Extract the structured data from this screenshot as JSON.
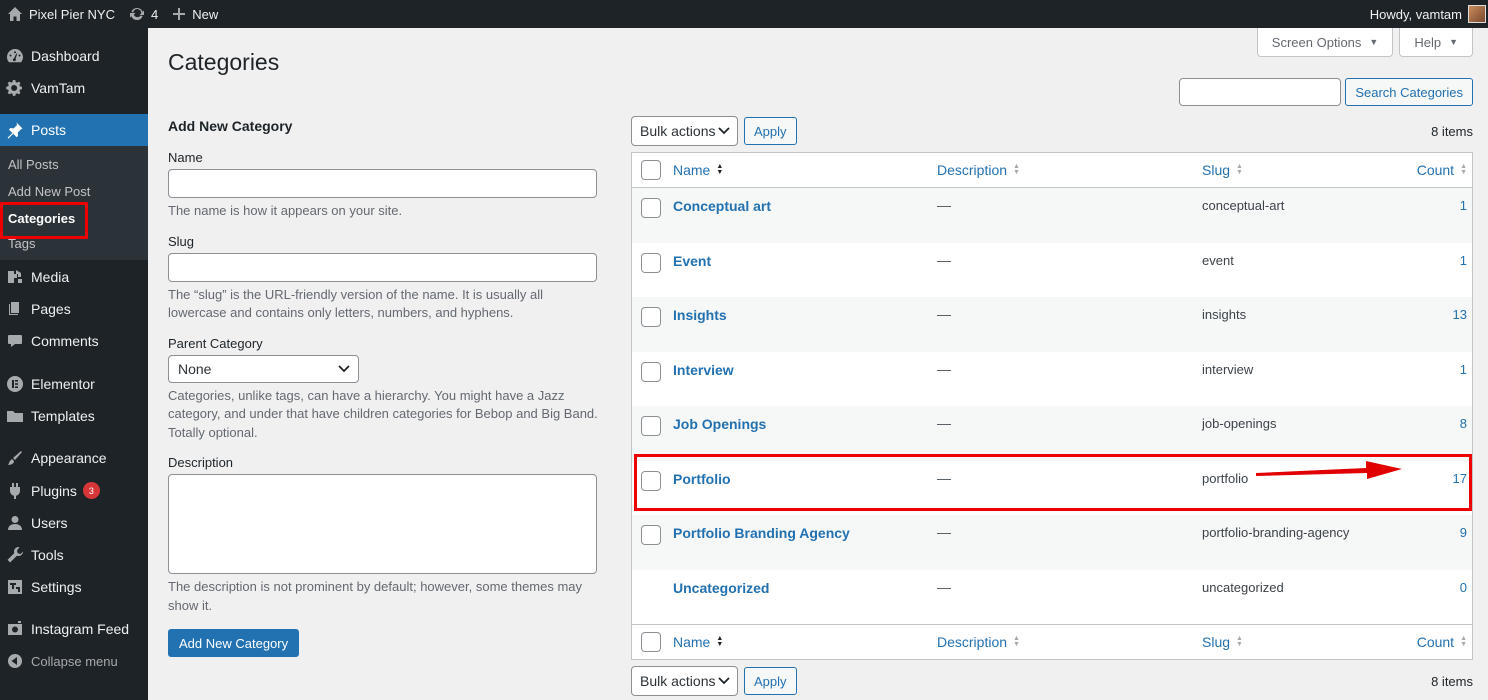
{
  "admin_bar": {
    "site_name": "Pixel Pier NYC",
    "updates_count": "4",
    "new_label": "New",
    "greeting": "Howdy, vamtam"
  },
  "sidebar": {
    "items": [
      {
        "label": "Dashboard",
        "icon": "dashboard-icon"
      },
      {
        "label": "VamTam",
        "icon": "gear-icon"
      },
      {
        "label": "Posts",
        "icon": "pin-icon"
      },
      {
        "label": "Media",
        "icon": "media-icon"
      },
      {
        "label": "Pages",
        "icon": "pages-icon"
      },
      {
        "label": "Comments",
        "icon": "comments-icon"
      },
      {
        "label": "Elementor",
        "icon": "elementor-icon"
      },
      {
        "label": "Templates",
        "icon": "folder-icon"
      },
      {
        "label": "Appearance",
        "icon": "brush-icon"
      },
      {
        "label": "Plugins",
        "icon": "plugin-icon",
        "badge": "3"
      },
      {
        "label": "Users",
        "icon": "user-icon"
      },
      {
        "label": "Tools",
        "icon": "wrench-icon"
      },
      {
        "label": "Settings",
        "icon": "settings-icon"
      },
      {
        "label": "Instagram Feed",
        "icon": "instagram-icon"
      }
    ],
    "posts_submenu": [
      "All Posts",
      "Add New Post",
      "Categories",
      "Tags"
    ],
    "collapse_label": "Collapse menu"
  },
  "header": {
    "title": "Categories",
    "screen_options": "Screen Options",
    "help": "Help",
    "search_button": "Search Categories"
  },
  "form": {
    "heading": "Add New Category",
    "name_label": "Name",
    "name_desc": "The name is how it appears on your site.",
    "slug_label": "Slug",
    "slug_desc": "The “slug” is the URL-friendly version of the name. It is usually all lowercase and contains only letters, numbers, and hyphens.",
    "parent_label": "Parent Category",
    "parent_value": "None",
    "parent_desc": "Categories, unlike tags, can have a hierarchy. You might have a Jazz category, and under that have children categories for Bebop and Big Band. Totally optional.",
    "description_label": "Description",
    "description_desc": "The description is not prominent by default; however, some themes may show it.",
    "submit_label": "Add New Category"
  },
  "list": {
    "bulk_label": "Bulk actions",
    "apply_label": "Apply",
    "items_count": "8 items",
    "columns": {
      "name": "Name",
      "description": "Description",
      "slug": "Slug",
      "count": "Count"
    },
    "rows": [
      {
        "name": "Conceptual art",
        "description": "—",
        "slug": "conceptual-art",
        "count": "1",
        "checkbox": true
      },
      {
        "name": "Event",
        "description": "—",
        "slug": "event",
        "count": "1",
        "checkbox": true
      },
      {
        "name": "Insights",
        "description": "—",
        "slug": "insights",
        "count": "13",
        "checkbox": true
      },
      {
        "name": "Interview",
        "description": "—",
        "slug": "interview",
        "count": "1",
        "checkbox": true
      },
      {
        "name": "Job Openings",
        "description": "—",
        "slug": "job-openings",
        "count": "8",
        "checkbox": true
      },
      {
        "name": "Portfolio",
        "description": "—",
        "slug": "portfolio",
        "count": "17",
        "checkbox": true
      },
      {
        "name": "Portfolio Branding Agency",
        "description": "—",
        "slug": "portfolio-branding-agency",
        "count": "9",
        "checkbox": true
      },
      {
        "name": "Uncategorized",
        "description": "—",
        "slug": "uncategorized",
        "count": "0",
        "checkbox": false
      }
    ]
  },
  "colors": {
    "accent": "#2271b1",
    "admin_dark": "#1d2327",
    "highlight": "#e00000"
  }
}
